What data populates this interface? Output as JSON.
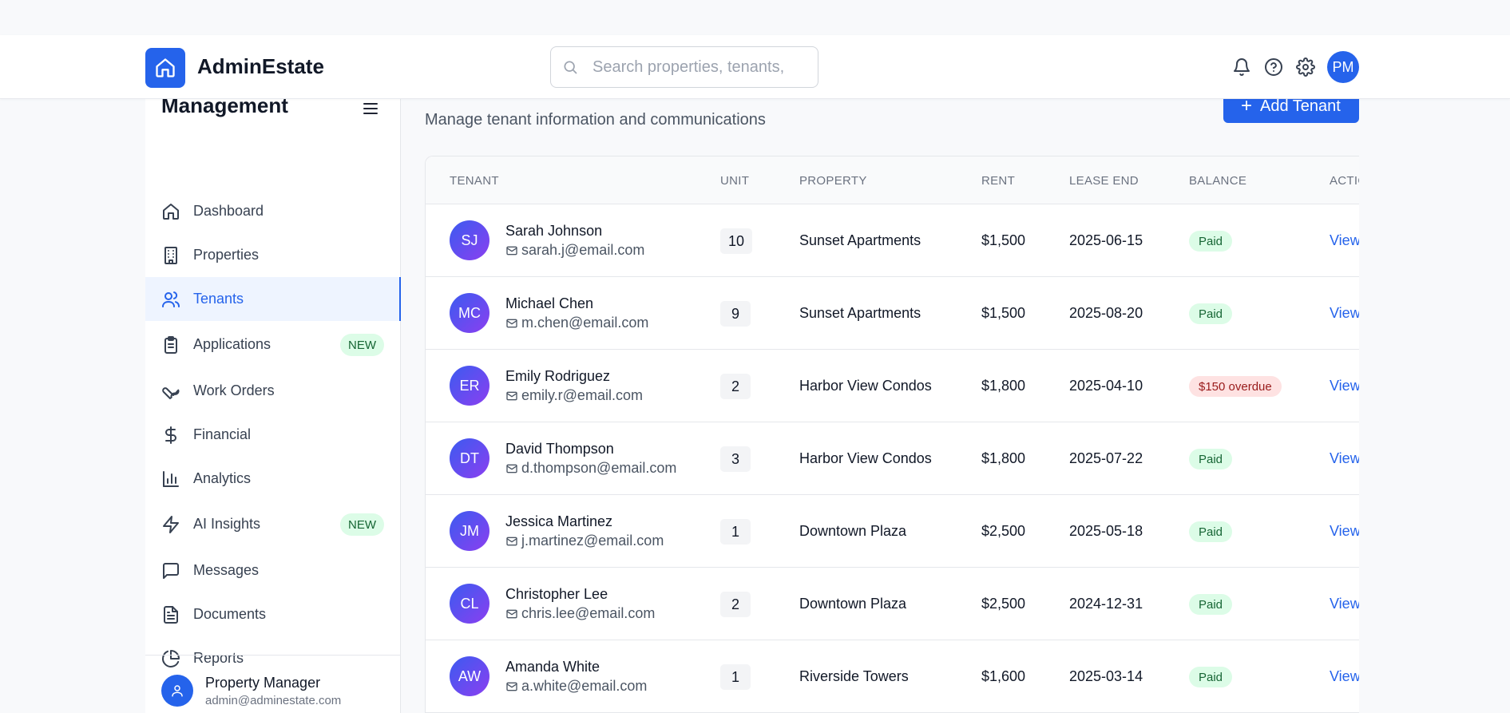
{
  "app": {
    "name": "AdminEstate"
  },
  "search": {
    "placeholder": "Search properties, tenants,"
  },
  "header": {
    "user_initials": "PM"
  },
  "sidebar": {
    "title": "Management",
    "items": [
      {
        "label": "Dashboard",
        "icon": "home-icon"
      },
      {
        "label": "Properties",
        "icon": "building-icon"
      },
      {
        "label": "Tenants",
        "icon": "users-icon",
        "active": true
      },
      {
        "label": "Applications",
        "icon": "clipboard-icon",
        "badge": "NEW"
      },
      {
        "label": "Work Orders",
        "icon": "wrench-icon"
      },
      {
        "label": "Financial",
        "icon": "dollar-icon"
      },
      {
        "label": "Analytics",
        "icon": "bar-chart-icon"
      },
      {
        "label": "AI Insights",
        "icon": "zap-icon",
        "badge": "NEW"
      },
      {
        "label": "Messages",
        "icon": "message-icon"
      },
      {
        "label": "Documents",
        "icon": "file-text-icon"
      },
      {
        "label": "Reports",
        "icon": "pie-chart-icon"
      }
    ],
    "footer": {
      "name": "Property Manager",
      "email": "admin@adminestate.com"
    }
  },
  "page": {
    "title": "Tenants",
    "subtitle": "Manage tenant information and communications",
    "add_button": "Add Tenant"
  },
  "table": {
    "columns": [
      "TENANT",
      "UNIT",
      "PROPERTY",
      "RENT",
      "LEASE END",
      "BALANCE",
      "ACTIO"
    ],
    "rows": [
      {
        "initials": "SJ",
        "name": "Sarah Johnson",
        "email": "sarah.j@email.com",
        "unit": "10",
        "property": "Sunset Apartments",
        "rent": "$1,500",
        "lease_end": "2025-06-15",
        "balance": "Paid",
        "status": "paid",
        "action": "View"
      },
      {
        "initials": "MC",
        "name": "Michael Chen",
        "email": "m.chen@email.com",
        "unit": "9",
        "property": "Sunset Apartments",
        "rent": "$1,500",
        "lease_end": "2025-08-20",
        "balance": "Paid",
        "status": "paid",
        "action": "View"
      },
      {
        "initials": "ER",
        "name": "Emily Rodriguez",
        "email": "emily.r@email.com",
        "unit": "2",
        "property": "Harbor View Condos",
        "rent": "$1,800",
        "lease_end": "2025-04-10",
        "balance": "$150 overdue",
        "status": "overdue",
        "action": "View"
      },
      {
        "initials": "DT",
        "name": "David Thompson",
        "email": "d.thompson@email.com",
        "unit": "3",
        "property": "Harbor View Condos",
        "rent": "$1,800",
        "lease_end": "2025-07-22",
        "balance": "Paid",
        "status": "paid",
        "action": "View"
      },
      {
        "initials": "JM",
        "name": "Jessica Martinez",
        "email": "j.martinez@email.com",
        "unit": "1",
        "property": "Downtown Plaza",
        "rent": "$2,500",
        "lease_end": "2025-05-18",
        "balance": "Paid",
        "status": "paid",
        "action": "View"
      },
      {
        "initials": "CL",
        "name": "Christopher Lee",
        "email": "chris.lee@email.com",
        "unit": "2",
        "property": "Downtown Plaza",
        "rent": "$2,500",
        "lease_end": "2024-12-31",
        "balance": "Paid",
        "status": "paid",
        "action": "View"
      },
      {
        "initials": "AW",
        "name": "Amanda White",
        "email": "a.white@email.com",
        "unit": "1",
        "property": "Riverside Towers",
        "rent": "$1,600",
        "lease_end": "2025-03-14",
        "balance": "Paid",
        "status": "paid",
        "action": "View"
      }
    ]
  },
  "colors": {
    "accent": "#2563eb",
    "paid_bg": "#dcfce7",
    "paid_text": "#166534",
    "overdue_bg": "#fee2e2",
    "overdue_text": "#991b1b"
  }
}
